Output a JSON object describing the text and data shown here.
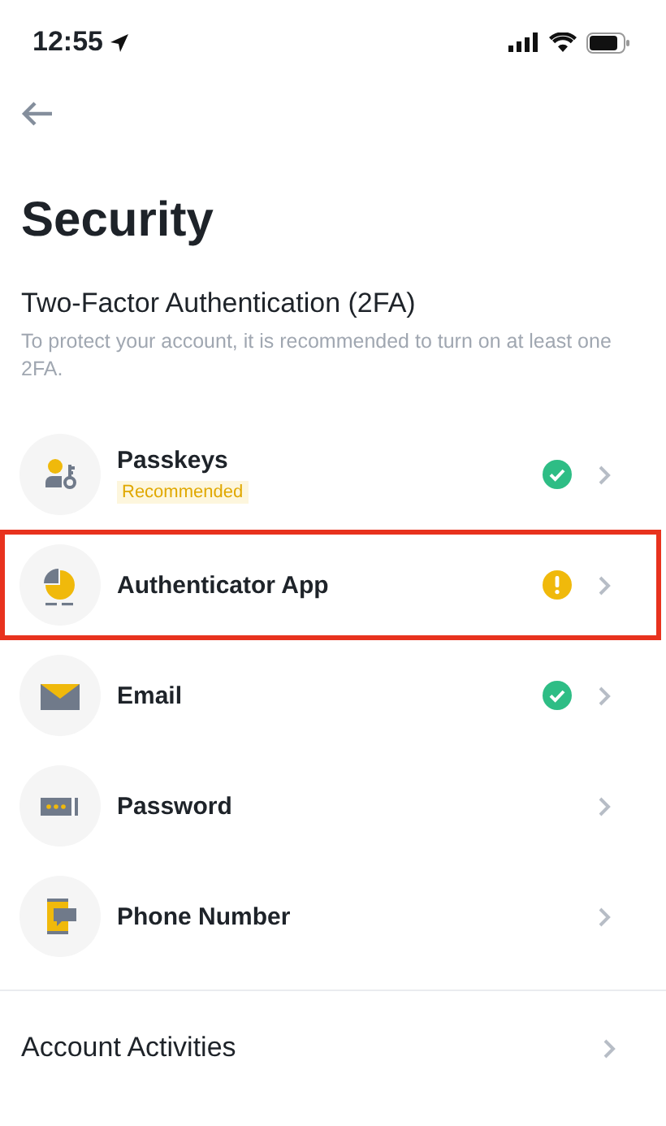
{
  "status_bar": {
    "time": "12:55"
  },
  "header": {
    "title": "Security"
  },
  "two_factor": {
    "heading": "Two-Factor Authentication (2FA)",
    "description": "To protect your account, it is recommended to turn on at least one 2FA.",
    "methods": [
      {
        "kind": "passkey",
        "label": "Passkeys",
        "badge": "Recommended",
        "verified": true,
        "warning": false,
        "highlighted": false
      },
      {
        "kind": "authenticator",
        "label": "Authenticator App",
        "verified": false,
        "warning": true,
        "highlighted": true
      },
      {
        "kind": "email",
        "label": "Email",
        "verified": true,
        "warning": false,
        "highlighted": false
      },
      {
        "kind": "password",
        "label": "Password",
        "verified": false,
        "warning": false,
        "highlighted": false
      },
      {
        "kind": "phone",
        "label": "Phone Number",
        "verified": false,
        "warning": false,
        "highlighted": false
      }
    ]
  },
  "other": [
    {
      "label": "Account Activities"
    }
  ]
}
